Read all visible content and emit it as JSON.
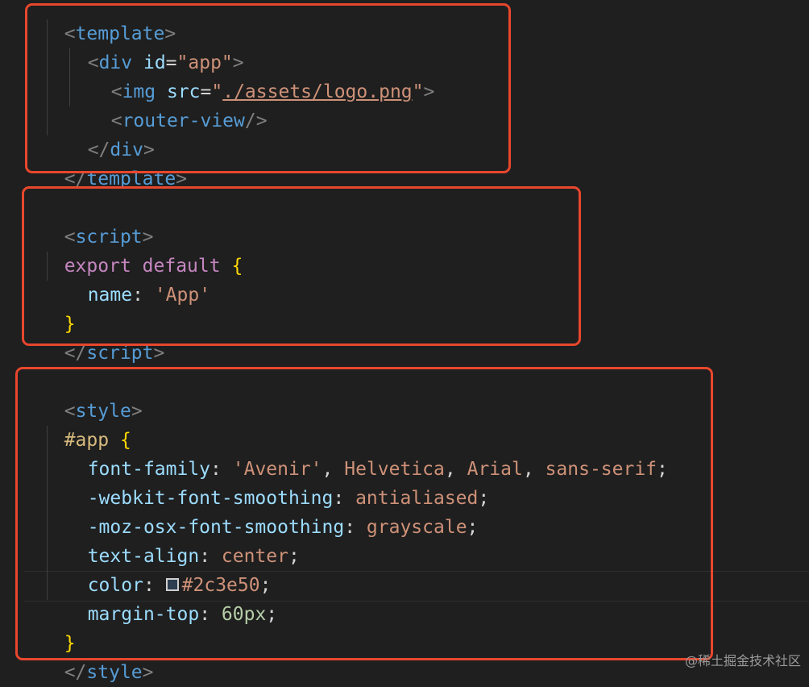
{
  "template_block": {
    "line0": {
      "open": "<",
      "tag": "template",
      "close": ">"
    },
    "line1": {
      "open": "<",
      "tag": "div",
      "attr": "id",
      "eq": "=",
      "value": "\"app\"",
      "close": ">"
    },
    "line2": {
      "open": "<",
      "tag": "img",
      "attr": "src",
      "eq": "=",
      "q1": "\"",
      "value": "./assets/logo.png",
      "q2": "\"",
      "close": ">"
    },
    "line3": {
      "open": "<",
      "tag": "router-view",
      "close": "/>"
    },
    "line4": {
      "open": "</",
      "tag": "div",
      "close": ">"
    },
    "line5": {
      "open": "</",
      "tag": "template",
      "close": ">"
    }
  },
  "script_block": {
    "line0": {
      "open": "<",
      "tag": "script",
      "close": ">"
    },
    "line1": {
      "kw1": "export",
      "kw2": "default",
      "brace": "{"
    },
    "line2": {
      "prop": "name",
      "colon": ":",
      "value": "'App'"
    },
    "line3": {
      "brace": "}"
    },
    "line4": {
      "open": "</",
      "tag": "script",
      "close": ">"
    }
  },
  "style_block": {
    "line0": {
      "open": "<",
      "tag": "style",
      "close": ">"
    },
    "line1": {
      "selector": "#app",
      "brace": "{"
    },
    "line2": {
      "prop": "font-family",
      "colon": ":",
      "v1": "'Avenir'",
      "c1": ",",
      "v2": "Helvetica",
      "c2": ",",
      "v3": "Arial",
      "c3": ",",
      "v4": "sans-serif",
      "semi": ";"
    },
    "line3": {
      "prop": "-webkit-font-smoothing",
      "colon": ":",
      "value": "antialiased",
      "semi": ";"
    },
    "line4": {
      "prop": "-moz-osx-font-smoothing",
      "colon": ":",
      "value": "grayscale",
      "semi": ";"
    },
    "line5": {
      "prop": "text-align",
      "colon": ":",
      "value": "center",
      "semi": ";"
    },
    "line6": {
      "prop": "color",
      "colon": ":",
      "value": "#2c3e50",
      "semi": ";"
    },
    "line7": {
      "prop": "margin-top",
      "colon": ":",
      "value": "60px",
      "semi": ";"
    },
    "line8": {
      "brace": "}"
    },
    "line9": {
      "open": "</",
      "tag": "style",
      "close": ">"
    }
  },
  "watermark": "@稀土掘金技术社区",
  "colors": {
    "highlight_box": "#e8472d",
    "swatch": "#2c3e50"
  }
}
